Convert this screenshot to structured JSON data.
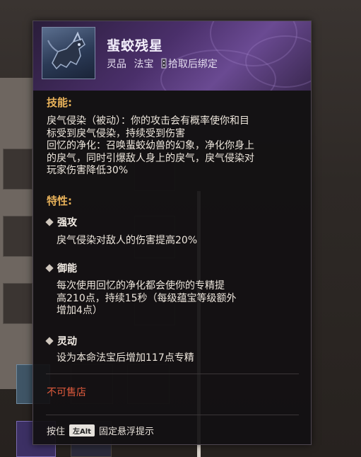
{
  "item": {
    "name": "蜚蛟残星",
    "grade": "灵品",
    "category": "法宝",
    "binding": "拾取后绑定",
    "icon": "beast-figurine-icon"
  },
  "skills": {
    "title": "技能:",
    "lines": [
      "戾气侵染（被动）：你的攻击会有概率使你和目",
      "标受到戾气侵染，持续受到伤害",
      "回忆的净化：召唤蜚蛟幼兽的幻象，净化你身上",
      "的戾气，同时引爆敌人身上的戾气，戾气侵染对",
      "玩家伤害降低30%"
    ]
  },
  "traits": {
    "title": "特性:",
    "items": [
      {
        "name": "强攻",
        "lines": [
          "戾气侵染对敌人的伤害提高20%"
        ]
      },
      {
        "name": "御能",
        "lines": [
          "每次使用回忆的净化都会使你的专精提",
          "高210点，持续15秒（每级蕴宝等级额外",
          "增加4点）"
        ]
      },
      {
        "name": "灵动",
        "lines": [
          "设为本命法宝后增加117点专精"
        ]
      }
    ]
  },
  "status": {
    "unsellable": "不可售店"
  },
  "footer": {
    "prefix": "按住",
    "key": "左Alt",
    "suffix": "固定悬浮提示"
  },
  "colors": {
    "section_title": "#e8b25a",
    "unsellable": "#e05a3c",
    "header": "#4a2f6a"
  }
}
